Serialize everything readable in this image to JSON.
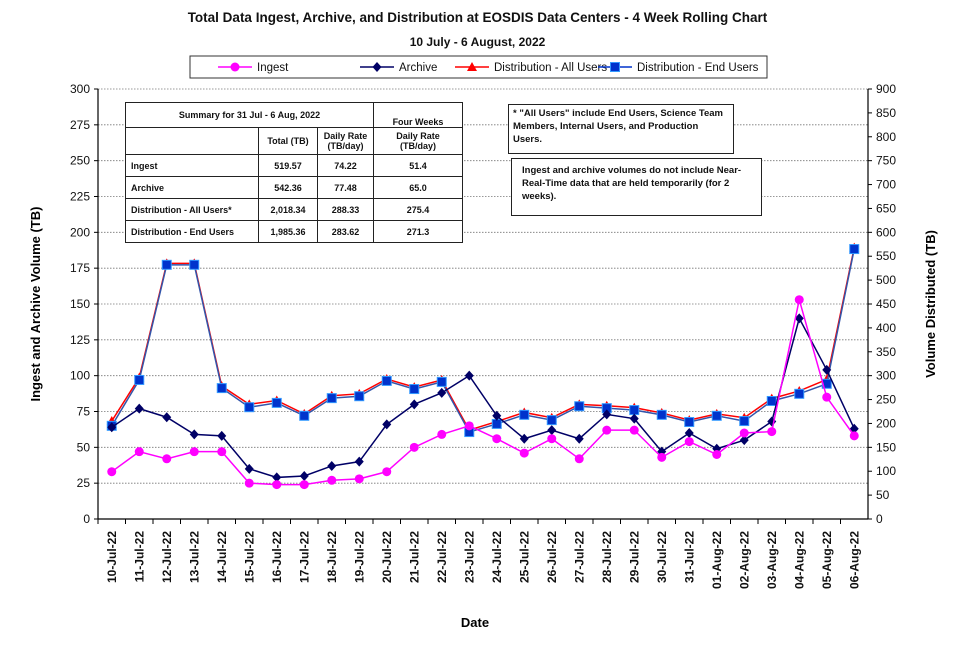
{
  "chart_data": {
    "type": "line",
    "title": "Total Data Ingest, Archive, and  Distribution at EOSDIS Data Centers - 4 Week Rolling Chart",
    "subtitle": "10 July  - 6 August, 2022",
    "xlabel": "Date",
    "ylabel": "Ingest and Archive Volume (TB)",
    "y2label": "Volume Distributed (TB)",
    "ylim": [
      0,
      300
    ],
    "y2lim": [
      0,
      900
    ],
    "yticks": [
      0,
      25,
      50,
      75,
      100,
      125,
      150,
      175,
      200,
      225,
      250,
      275,
      300
    ],
    "y2ticks": [
      0,
      50,
      100,
      150,
      200,
      250,
      300,
      350,
      400,
      450,
      500,
      550,
      600,
      650,
      700,
      750,
      800,
      850,
      900
    ],
    "grid": true,
    "legend_placement": "top",
    "categories": [
      "10-Jul-22",
      "11-Jul-22",
      "12-Jul-22",
      "13-Jul-22",
      "14-Jul-22",
      "15-Jul-22",
      "16-Jul-22",
      "17-Jul-22",
      "18-Jul-22",
      "19-Jul-22",
      "20-Jul-22",
      "21-Jul-22",
      "22-Jul-22",
      "23-Jul-22",
      "24-Jul-22",
      "25-Jul-22",
      "26-Jul-22",
      "27-Jul-22",
      "28-Jul-22",
      "29-Jul-22",
      "30-Jul-22",
      "31-Jul-22",
      "01-Aug-22",
      "02-Aug-22",
      "03-Aug-22",
      "04-Aug-22",
      "05-Aug-22",
      "06-Aug-22"
    ],
    "series": [
      {
        "name": "Ingest",
        "axis": "left",
        "color": "#ff00ff",
        "marker": "circle",
        "values": [
          33,
          47,
          42,
          47,
          47,
          25,
          24,
          24,
          27,
          28,
          33,
          50,
          59,
          65,
          56,
          46,
          56,
          42,
          62,
          62,
          43,
          54,
          45,
          60,
          61,
          153,
          85,
          58
        ]
      },
      {
        "name": "Archive",
        "axis": "left",
        "color": "#000066",
        "marker": "diamond",
        "values": [
          64,
          77,
          71,
          59,
          58,
          35,
          29,
          30,
          37,
          40,
          66,
          80,
          88,
          100,
          72,
          56,
          62,
          56,
          73,
          70,
          47,
          60,
          49,
          55,
          68,
          140,
          104,
          63
        ]
      },
      {
        "name": "Distribution - All Users",
        "axis": "right",
        "color": "#ff0000",
        "marker": "triangle",
        "values": [
          205,
          296,
          535,
          535,
          278,
          240,
          248,
          220,
          258,
          262,
          293,
          276,
          291,
          186,
          204,
          223,
          212,
          240,
          237,
          233,
          222,
          207,
          220,
          212,
          252,
          268,
          292,
          568
        ]
      },
      {
        "name": "Distribution - End Users",
        "axis": "right",
        "color": "#0033cc",
        "marker": "square",
        "values": [
          195,
          291,
          532,
          532,
          274,
          234,
          243,
          216,
          253,
          257,
          289,
          272,
          287,
          182,
          199,
          218,
          207,
          236,
          232,
          228,
          218,
          203,
          216,
          205,
          247,
          262,
          283,
          565
        ]
      }
    ],
    "summary_table": {
      "title": "Summary for 31 Jul  - 6 Aug, 2022",
      "four_weeks": "Four Weeks",
      "col_total": "Total (TB)",
      "col_daily": "Daily Rate (TB/day)",
      "col_four": "Daily Rate (TB/day)",
      "rows": [
        {
          "label": "Ingest",
          "total": "519.57",
          "daily": "74.22",
          "four": "51.4"
        },
        {
          "label": "Archive",
          "total": "542.36",
          "daily": "77.48",
          "four": "65.0"
        },
        {
          "label": "Distribution - All Users*",
          "total": "2,018.34",
          "daily": "288.33",
          "four": "275.4"
        },
        {
          "label": "Distribution - End Users",
          "total": "1,985.36",
          "daily": "283.62",
          "four": "271.3"
        }
      ]
    },
    "notes": [
      "* \"All Users\" include End Users, Science Team Members,  Internal Users, and Production Users.",
      "Ingest and archive volumes do not include Near-Real-Time data that are held temporarily (for 2 weeks)."
    ]
  }
}
